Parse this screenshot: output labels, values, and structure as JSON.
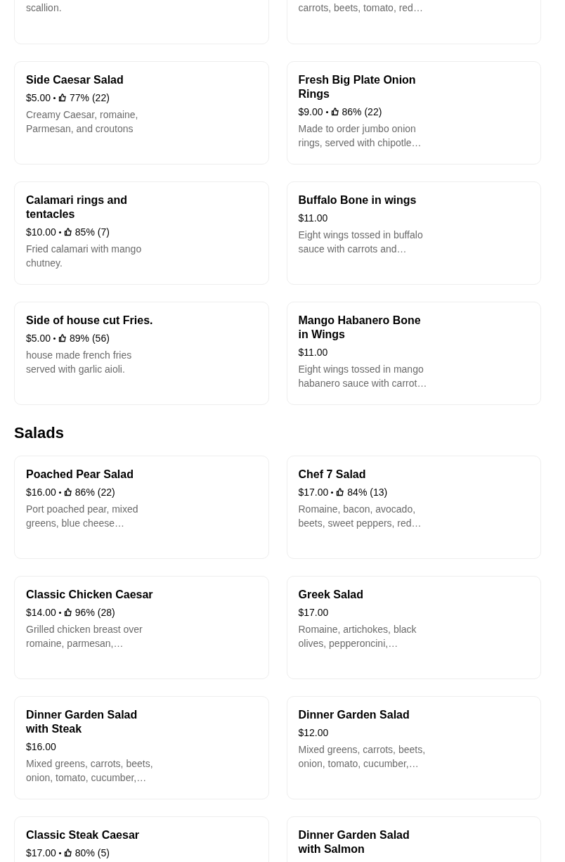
{
  "partial_items": [
    {
      "description": "scallion."
    },
    {
      "description": "carrots, beets, tomato, red…"
    }
  ],
  "sections": [
    {
      "items": [
        {
          "name": "Side Caesar Salad",
          "price": "$5.00",
          "rating": "77% (22)",
          "description": "Creamy Caesar, romaine, Parmesan, and croutons"
        },
        {
          "name": "Fresh Big Plate Onion Rings",
          "price": "$9.00",
          "rating": "86% (22)",
          "description": "Made to order jumbo onion rings, served with chipotle…"
        },
        {
          "name": "Calamari rings and tentacles",
          "price": "$10.00",
          "rating": "85% (7)",
          "description": "Fried calamari with mango chutney."
        },
        {
          "name": "Buffalo Bone in wings",
          "price": "$11.00",
          "description": "Eight wings tossed in buffalo sauce with carrots and…"
        },
        {
          "name": "Side of house cut Fries.",
          "price": "$5.00",
          "rating": "89% (56)",
          "description": "house made french fries served with garlic aioli."
        },
        {
          "name": "Mango Habanero Bone in Wings",
          "price": "$11.00",
          "description": "Eight wings tossed in mango habanero sauce with carrot…"
        }
      ]
    },
    {
      "title": "Salads",
      "items": [
        {
          "name": "Poached Pear Salad",
          "price": "$16.00",
          "rating": "86% (22)",
          "description": "Port poached pear, mixed greens, blue cheese…"
        },
        {
          "name": "Chef 7 Salad",
          "price": "$17.00",
          "rating": "84% (13)",
          "description": "Romaine, bacon, avocado, beets, sweet peppers, red…"
        },
        {
          "name": "Classic Chicken Caesar",
          "price": "$14.00",
          "rating": "96% (28)",
          "description": "Grilled chicken breast over romaine, parmesan,…"
        },
        {
          "name": "Greek Salad",
          "price": "$17.00",
          "description": "Romaine, artichokes, black olives, pepperoncini,…"
        },
        {
          "name": "Dinner Garden Salad with Steak",
          "price": "$16.00",
          "description": "Mixed greens, carrots, beets, onion, tomato, cucumber,…"
        },
        {
          "name": "Dinner Garden Salad",
          "price": "$12.00",
          "description": "Mixed greens, carrots, beets, onion, tomato, cucumber,…"
        },
        {
          "name": "Classic Steak Caesar",
          "price": "$17.00",
          "rating": "80% (5)"
        },
        {
          "name": "Dinner Garden Salad with Salmon"
        }
      ]
    }
  ]
}
